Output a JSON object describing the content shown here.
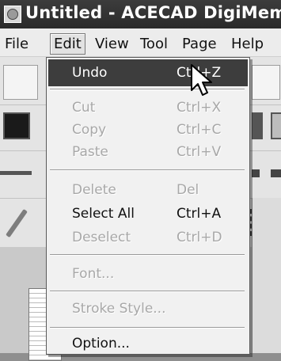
{
  "window": {
    "title": "Untitled - ACECAD DigiMemo Man"
  },
  "menubar": {
    "items": [
      {
        "label": "File"
      },
      {
        "label": "Edit"
      },
      {
        "label": "View"
      },
      {
        "label": "Tool"
      },
      {
        "label": "Page"
      },
      {
        "label": "Help"
      }
    ]
  },
  "edit_menu": {
    "undo": {
      "label": "Undo",
      "shortcut": "Ctrl+Z"
    },
    "cut": {
      "label": "Cut",
      "shortcut": "Ctrl+X"
    },
    "copy": {
      "label": "Copy",
      "shortcut": "Ctrl+C"
    },
    "paste": {
      "label": "Paste",
      "shortcut": "Ctrl+V"
    },
    "delete": {
      "label": "Delete",
      "shortcut": "Del"
    },
    "select_all": {
      "label": "Select All",
      "shortcut": "Ctrl+A"
    },
    "deselect": {
      "label": "Deselect",
      "shortcut": "Ctrl+D"
    },
    "font": {
      "label": "Font..."
    },
    "stroke_style": {
      "label": "Stroke Style..."
    },
    "option": {
      "label": "Option..."
    }
  },
  "icons": [
    "app-icon",
    "new-page-icon",
    "print-icon",
    "color-swatch-icon",
    "pen-icon",
    "arrow-cursor-icon"
  ]
}
